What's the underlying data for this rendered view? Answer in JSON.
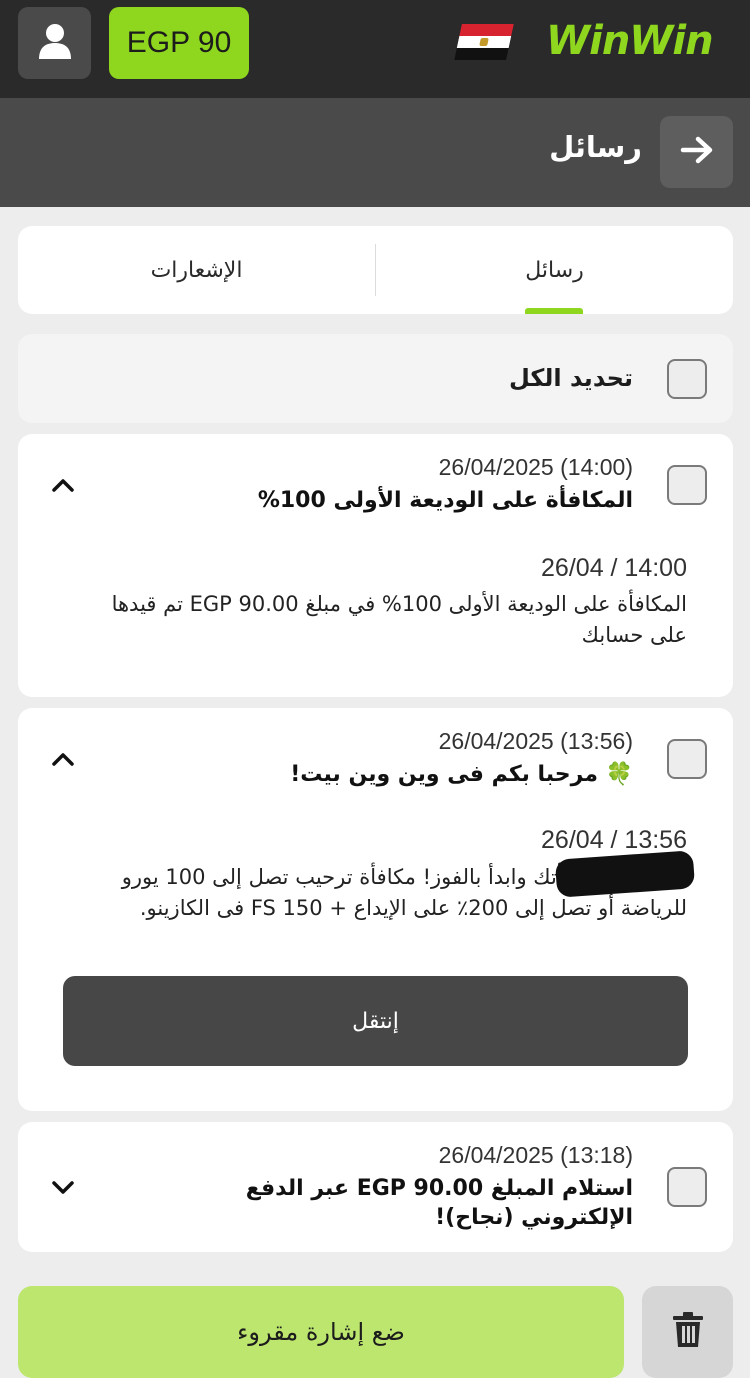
{
  "topbar": {
    "balance": "EGP 90",
    "logo_text": "WinWin",
    "accent_color": "#8fd61e",
    "user_icon": "user-icon",
    "flag_icon": "egypt-flag-icon"
  },
  "header": {
    "title": "رسائل",
    "back_icon": "arrow-right-icon"
  },
  "tabs": [
    {
      "label": "رسائل",
      "active": true
    },
    {
      "label": "الإشعارات",
      "active": false
    }
  ],
  "select_all": {
    "label": "تحديد الكل"
  },
  "messages": [
    {
      "date": "26/04/2025 (14:00)",
      "title": "المكافأة على الوديعة الأولى 100%",
      "expanded": true,
      "body_date": "26/04 / 14:00",
      "body_text": "المكافأة على الوديعة الأولى 100% في مبلغ EGP 90.00 تم قيدها على حسابك"
    },
    {
      "date": "26/04/2025 (13:56)",
      "title": "🍀 مرحبا بكم فى وين وين بيت!",
      "expanded": true,
      "body_date": "26/04 / 13:56",
      "body_text": "Ah, اختر مكافأتك وابدأ بالفوز! مكافأة ترحيب تصل إلى 100 يورو للرياضة أو تصل إلى 200٪ على الإيداع + 150 FS فى الكازينو.",
      "button_label": "إنتقل"
    },
    {
      "date": "26/04/2025 (13:18)",
      "title": "استلام المبلغ EGP 90.00 عبر الدفع الإلكتروني (نجاح)!",
      "expanded": false
    }
  ],
  "bottom": {
    "mark_read_label": "ضع إشارة مقروء",
    "delete_icon": "trash-icon"
  }
}
